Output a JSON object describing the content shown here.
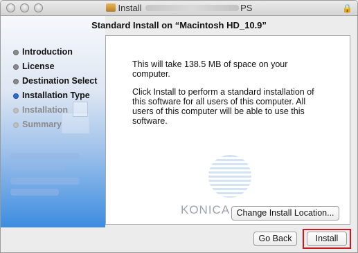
{
  "window": {
    "title_prefix": "Install",
    "title_suffix": "PS",
    "heading": "Standard Install on “Macintosh HD_10.9”"
  },
  "sidebar": {
    "steps": [
      {
        "label": "Introduction",
        "state": "done"
      },
      {
        "label": "License",
        "state": "done"
      },
      {
        "label": "Destination Select",
        "state": "done"
      },
      {
        "label": "Installation Type",
        "state": "current"
      },
      {
        "label": "Installation",
        "state": "pending"
      },
      {
        "label": "Summary",
        "state": "pending"
      }
    ]
  },
  "content": {
    "space_text": "This will take 138.5 MB of space on your computer.",
    "install_text": "Click Install to perform a standard installation of this software for all users of this computer. All users of this computer will be able to use this software.",
    "logo_text": "KONICA",
    "change_location_label": "Change Install Location..."
  },
  "footer": {
    "back_label": "Go Back",
    "install_label": "Install"
  },
  "colors": {
    "current_step": "#2f6fd0",
    "highlight_box": "#d0161b"
  }
}
